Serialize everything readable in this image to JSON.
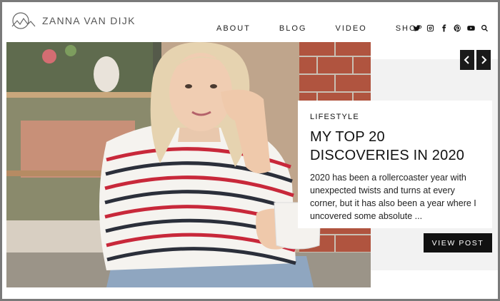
{
  "site": {
    "logo_text": "ZANNA VAN DIJK"
  },
  "nav": {
    "items": [
      "ABOUT",
      "BLOG",
      "VIDEO",
      "SHOP"
    ]
  },
  "social": {
    "icons": [
      "twitter-icon",
      "instagram-icon",
      "facebook-icon",
      "pinterest-icon",
      "youtube-icon",
      "search-icon"
    ]
  },
  "featured": {
    "category": "LIFESTYLE",
    "title": "MY TOP 20 DISCOVERIES IN 2020",
    "excerpt": "2020 has been a rollercoaster year with unexpected twists and turns at every corner, but it has also been a year where I uncovered some absolute ...",
    "button_label": "VIEW POST"
  },
  "colors": {
    "accent": "#111111",
    "panel": "#f2f2f2",
    "frame": "#7a7a7a"
  }
}
